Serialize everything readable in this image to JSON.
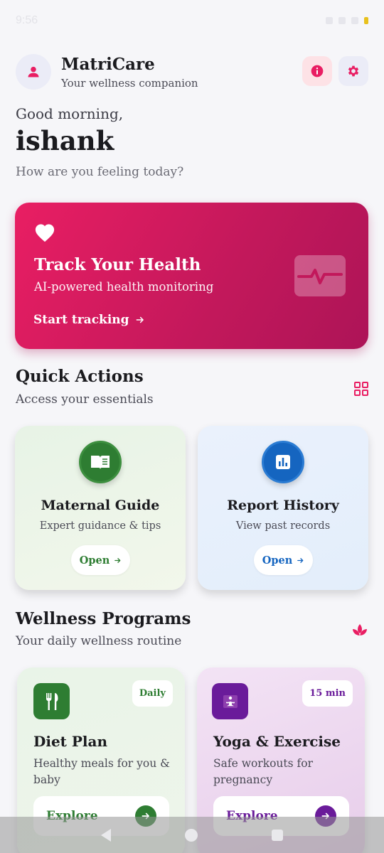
{
  "status": {
    "time": "9:56"
  },
  "header": {
    "app_title": "MatriCare",
    "app_subtitle": "Your wellness companion",
    "icons": [
      "person-icon",
      "info-icon",
      "gear-icon"
    ]
  },
  "greeting": {
    "salutation": "Good morning,",
    "name": "ishank",
    "prompt": "How are you feeling today?"
  },
  "hero": {
    "title": "Track Your Health",
    "subtitle": "AI-powered health monitoring",
    "cta": "Start tracking",
    "icons": [
      "heart-icon",
      "pulse-icon",
      "arrow-right-icon"
    ],
    "gradient": [
      "#e91e63",
      "#ad1457"
    ]
  },
  "quick_actions": {
    "title": "Quick Actions",
    "subtitle": "Access your essentials",
    "items": [
      {
        "title": "Maternal Guide",
        "subtitle": "Expert guidance & tips",
        "button": "Open",
        "icon": "book-icon",
        "color": "#2e7d32"
      },
      {
        "title": "Report History",
        "subtitle": "View past records",
        "button": "Open",
        "icon": "chart-report-icon",
        "color": "#1565c0"
      }
    ]
  },
  "wellness": {
    "title": "Wellness Programs",
    "subtitle": "Your daily wellness routine",
    "items": [
      {
        "title": "Diet Plan",
        "description": "Healthy meals for you & baby",
        "badge": "Daily",
        "button": "Explore",
        "icon": "utensils-icon",
        "color": "#2e7d32"
      },
      {
        "title": "Yoga & Exercise",
        "description": "Safe workouts for pregnancy",
        "badge": "15 min",
        "button": "Explore",
        "icon": "yoga-icon",
        "color": "#6a1b9a"
      }
    ]
  }
}
